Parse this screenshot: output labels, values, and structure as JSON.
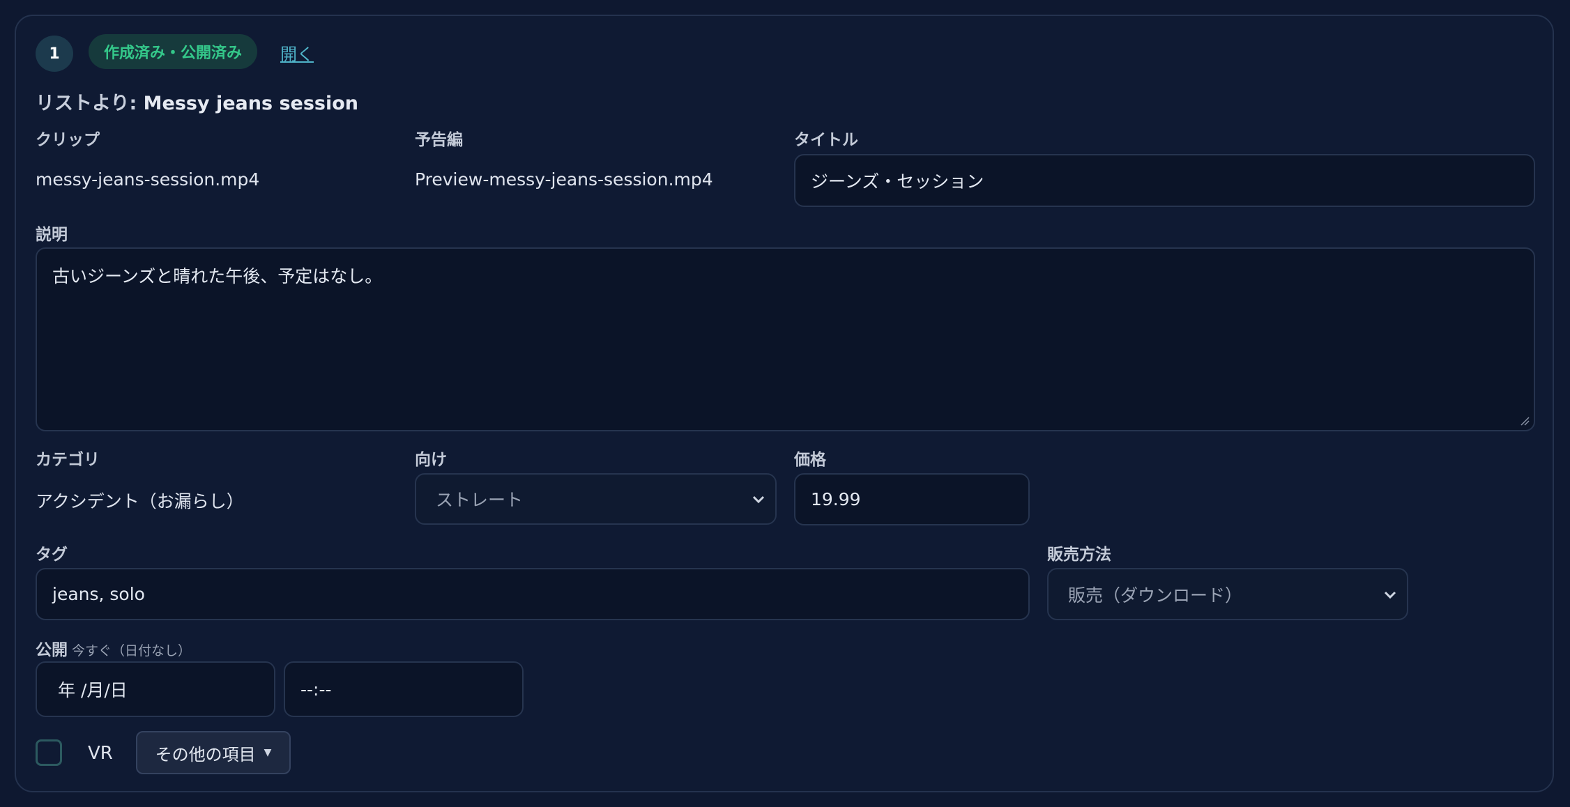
{
  "item": {
    "number": "1",
    "status": "作成済み・公開済み",
    "open_link": "開く",
    "source_prefix": "リストより:",
    "source_name": "Messy jeans session"
  },
  "fields": {
    "clip_label": "クリップ",
    "clip_value": "messy-jeans-session.mp4",
    "trailer_label": "予告編",
    "trailer_value": "Preview-messy-jeans-session.mp4",
    "title_label": "タイトル",
    "title_value": "ジーンズ・セッション",
    "description_label": "説明",
    "description_value": "古いジーンズと晴れた午後、予定はなし。",
    "category_label": "カテゴリ",
    "category_value": "アクシデント（お漏らし）",
    "audience_label": "向け",
    "audience_value": "ストレート",
    "price_label": "価格",
    "price_value": "19.99",
    "tags_label": "タグ",
    "tags_value": "jeans, solo",
    "sales_label": "販売方法",
    "sales_value": "販売（ダウンロード）",
    "publish_label": "公開",
    "publish_note": "今すぐ（日付なし）",
    "date_value": "年 /月/日",
    "time_value": "--:--",
    "vr_label": "VR",
    "more_button": "その他の項目"
  },
  "colors": {
    "background": "#0e1830",
    "accent_green": "#34c88a",
    "link": "#4fb3c8"
  }
}
